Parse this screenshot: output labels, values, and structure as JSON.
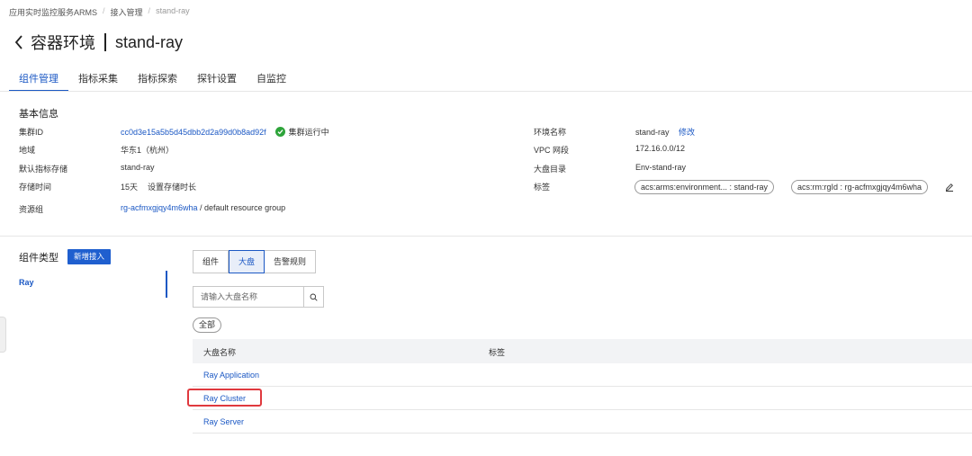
{
  "breadcrumb": {
    "items": [
      "应用实时监控服务ARMS",
      "接入管理",
      "stand-ray"
    ],
    "separator": "/"
  },
  "header": {
    "title": "容器环境",
    "env_name": "stand-ray"
  },
  "tabs": [
    {
      "label": "组件管理",
      "active": true
    },
    {
      "label": "指标采集",
      "active": false
    },
    {
      "label": "指标探索",
      "active": false
    },
    {
      "label": "探针设置",
      "active": false
    },
    {
      "label": "自监控",
      "active": false
    }
  ],
  "basic_info": {
    "title": "基本信息",
    "cluster_id_label": "集群ID",
    "cluster_id": "cc0d3e15a5b5d45dbb2d2a99d0b8ad92f",
    "cluster_status": "集群运行中",
    "region_label": "地域",
    "region": "华东1（杭州）",
    "storage_label": "默认指标存储",
    "storage": "stand-ray",
    "retention_label": "存储时间",
    "retention": "15天",
    "retention_action": "设置存储时长",
    "resource_group_label": "资源组",
    "resource_group_id": "rg-acfmxgjqy4m6wha",
    "resource_group_suffix": " / default resource group",
    "env_name_label": "环境名称",
    "env_name": "stand-ray",
    "env_edit": "修改",
    "vpc_label": "VPC 网段",
    "vpc": "172.16.0.0/12",
    "dashboard_dir_label": "大盘目录",
    "dashboard_dir": "Env-stand-ray",
    "tags_label": "标签",
    "tags": [
      "acs:arms:environment... : stand-ray",
      "acs:rm:rgId : rg-acfmxgjqy4m6wha"
    ]
  },
  "component": {
    "title": "组件类型",
    "add_button": "新增接入",
    "items": [
      {
        "label": "Ray",
        "active": true
      }
    ]
  },
  "segments": [
    {
      "label": "组件",
      "active": false
    },
    {
      "label": "大盘",
      "active": true
    },
    {
      "label": "告警规则",
      "active": false
    }
  ],
  "search": {
    "placeholder": "请输入大盘名称"
  },
  "filter_chip": "全部",
  "table": {
    "columns": [
      "大盘名称",
      "标签"
    ],
    "rows": [
      {
        "name": "Ray Application"
      },
      {
        "name": "Ray Cluster"
      },
      {
        "name": "Ray Server"
      }
    ]
  },
  "colors": {
    "accent": "#1b58c4",
    "primary_button": "#1f5fcf",
    "success": "#2ea43a",
    "highlight_border": "#e0393e"
  }
}
